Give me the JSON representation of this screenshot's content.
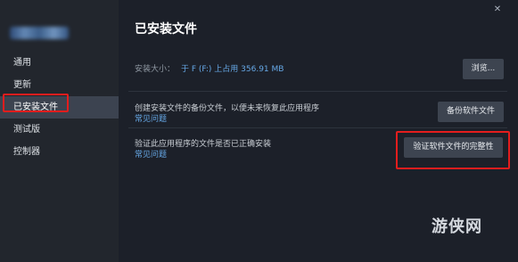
{
  "sidebar": {
    "items": [
      {
        "label": "通用"
      },
      {
        "label": "更新"
      },
      {
        "label": "已安装文件"
      },
      {
        "label": "测试版"
      },
      {
        "label": "控制器"
      }
    ]
  },
  "close_glyph": "✕",
  "main": {
    "title": "已安装文件",
    "install_size_label": "安装大小：",
    "install_size_value": "于 F (F:) 上占用 356.91 MB",
    "browse_button": "浏览...",
    "backup_description": "创建安装文件的备份文件，以便未来恢复此应用程序",
    "backup_faq": "常见问题",
    "backup_button": "备份软件文件",
    "verify_description": "验证此应用程序的文件是否已正确安装",
    "verify_faq": "常见问题",
    "verify_button": "验证软件文件的完整性"
  },
  "watermark": "游侠网"
}
